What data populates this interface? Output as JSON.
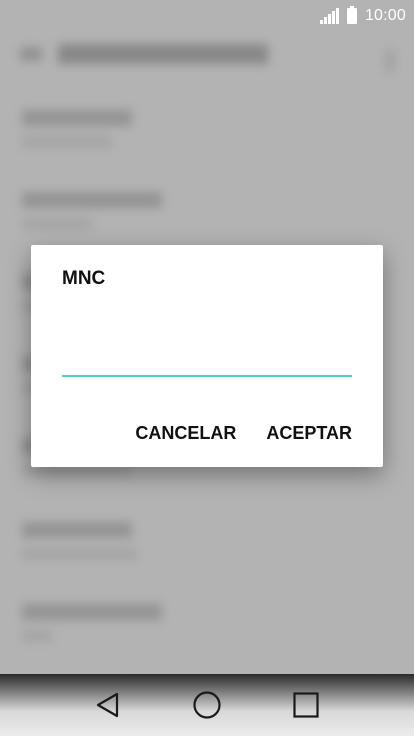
{
  "status_bar": {
    "time": "10:00",
    "signal_icon": "signal-icon",
    "battery_icon": "battery-icon"
  },
  "dialog": {
    "title": "MNC",
    "input_value": "",
    "input_accent": "#4fd1c5",
    "cancel_label": "CANCELAR",
    "ok_label": "ACEPTAR"
  },
  "nav_bar": {
    "back_icon": "back-icon",
    "home_icon": "home-icon",
    "recents_icon": "recents-icon"
  }
}
